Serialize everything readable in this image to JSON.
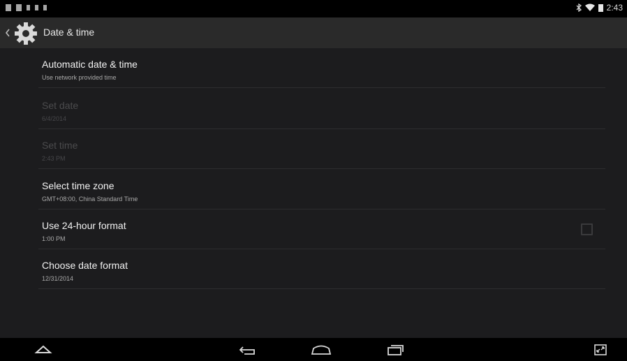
{
  "status_bar": {
    "time": "2:43",
    "left_icons": [
      "notification-icon",
      "mail-icon",
      "usb-icon",
      "download-icon",
      "battery-small-icon"
    ],
    "right_icons": [
      "bluetooth-icon",
      "wifi-icon",
      "battery-icon"
    ]
  },
  "action_bar": {
    "title": "Date & time",
    "icon": "gear-icon"
  },
  "settings": {
    "items": [
      {
        "title": "Automatic date & time",
        "summary": "Use network provided time",
        "enabled": true
      },
      {
        "title": "Set date",
        "summary": "6/4/2014",
        "enabled": false
      },
      {
        "title": "Set time",
        "summary": "2:43 PM",
        "enabled": false
      },
      {
        "title": "Select time zone",
        "summary": "GMT+08:00, China Standard Time",
        "enabled": true
      },
      {
        "title": "Use 24-hour format",
        "summary": "1:00 PM",
        "enabled": true,
        "checked": false
      },
      {
        "title": "Choose date format",
        "summary": "12/31/2014",
        "enabled": true
      }
    ]
  },
  "nav_bar": {
    "buttons": [
      "hide-keyboard-icon",
      "back-icon",
      "home-icon",
      "recents-icon",
      "screenshot-icon"
    ]
  },
  "colors": {
    "background": "#1c1c1e",
    "action_bar": "#2a2a2a",
    "divider": "#2d2d2f",
    "disabled_text": "#4b4b4d"
  }
}
